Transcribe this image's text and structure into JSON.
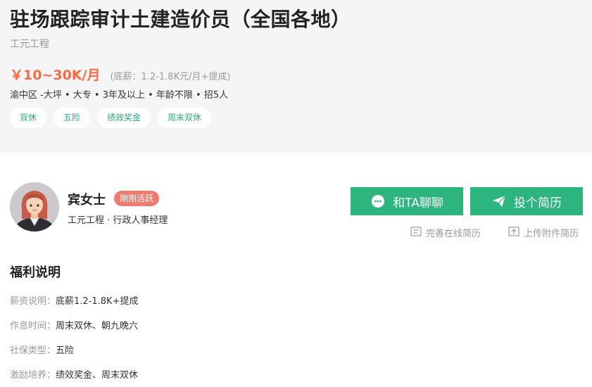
{
  "job": {
    "title": "驻场跟踪审计土建造价员（全国各地）",
    "company": "工元工程",
    "salary": "￥10~30K/月",
    "base_salary": "(底薪：1.2-1.8K元/月+提成)",
    "meta": "渝中区 -大坪  •  大专  •  3年及以上  • 年龄不限 • 招5人",
    "tags": [
      "双休",
      "五险",
      "绩效奖金",
      "周末双休"
    ]
  },
  "recruiter": {
    "name": "宾女士",
    "status": "刚刚活跃",
    "subtitle": "工元工程 · 行政人事经理"
  },
  "actions": {
    "chat_label": "和TA聊聊",
    "apply_label": "投个简历",
    "online_resume": "完善在线简历",
    "upload_resume": "上传附件简历"
  },
  "benefits": {
    "title": "福利说明",
    "items": [
      {
        "label": "薪资说明：",
        "value": "底薪1.2-1.8K+提成"
      },
      {
        "label": "作息时间：",
        "value": "周末双休、朝九晚六"
      },
      {
        "label": "社保类型：",
        "value": "五险"
      },
      {
        "label": "激励培养：",
        "value": "绩效奖金、周末双休"
      }
    ]
  },
  "colors": {
    "accent_green": "#2eb57f",
    "salary_orange": "#fa6a41",
    "badge_red": "#f07a6d",
    "header_bg": "#f5f5f7"
  },
  "icons": {
    "chat": "chat-bubble-icon",
    "apply": "paper-plane-icon",
    "online_resume": "document-icon",
    "upload_resume": "upload-icon"
  }
}
